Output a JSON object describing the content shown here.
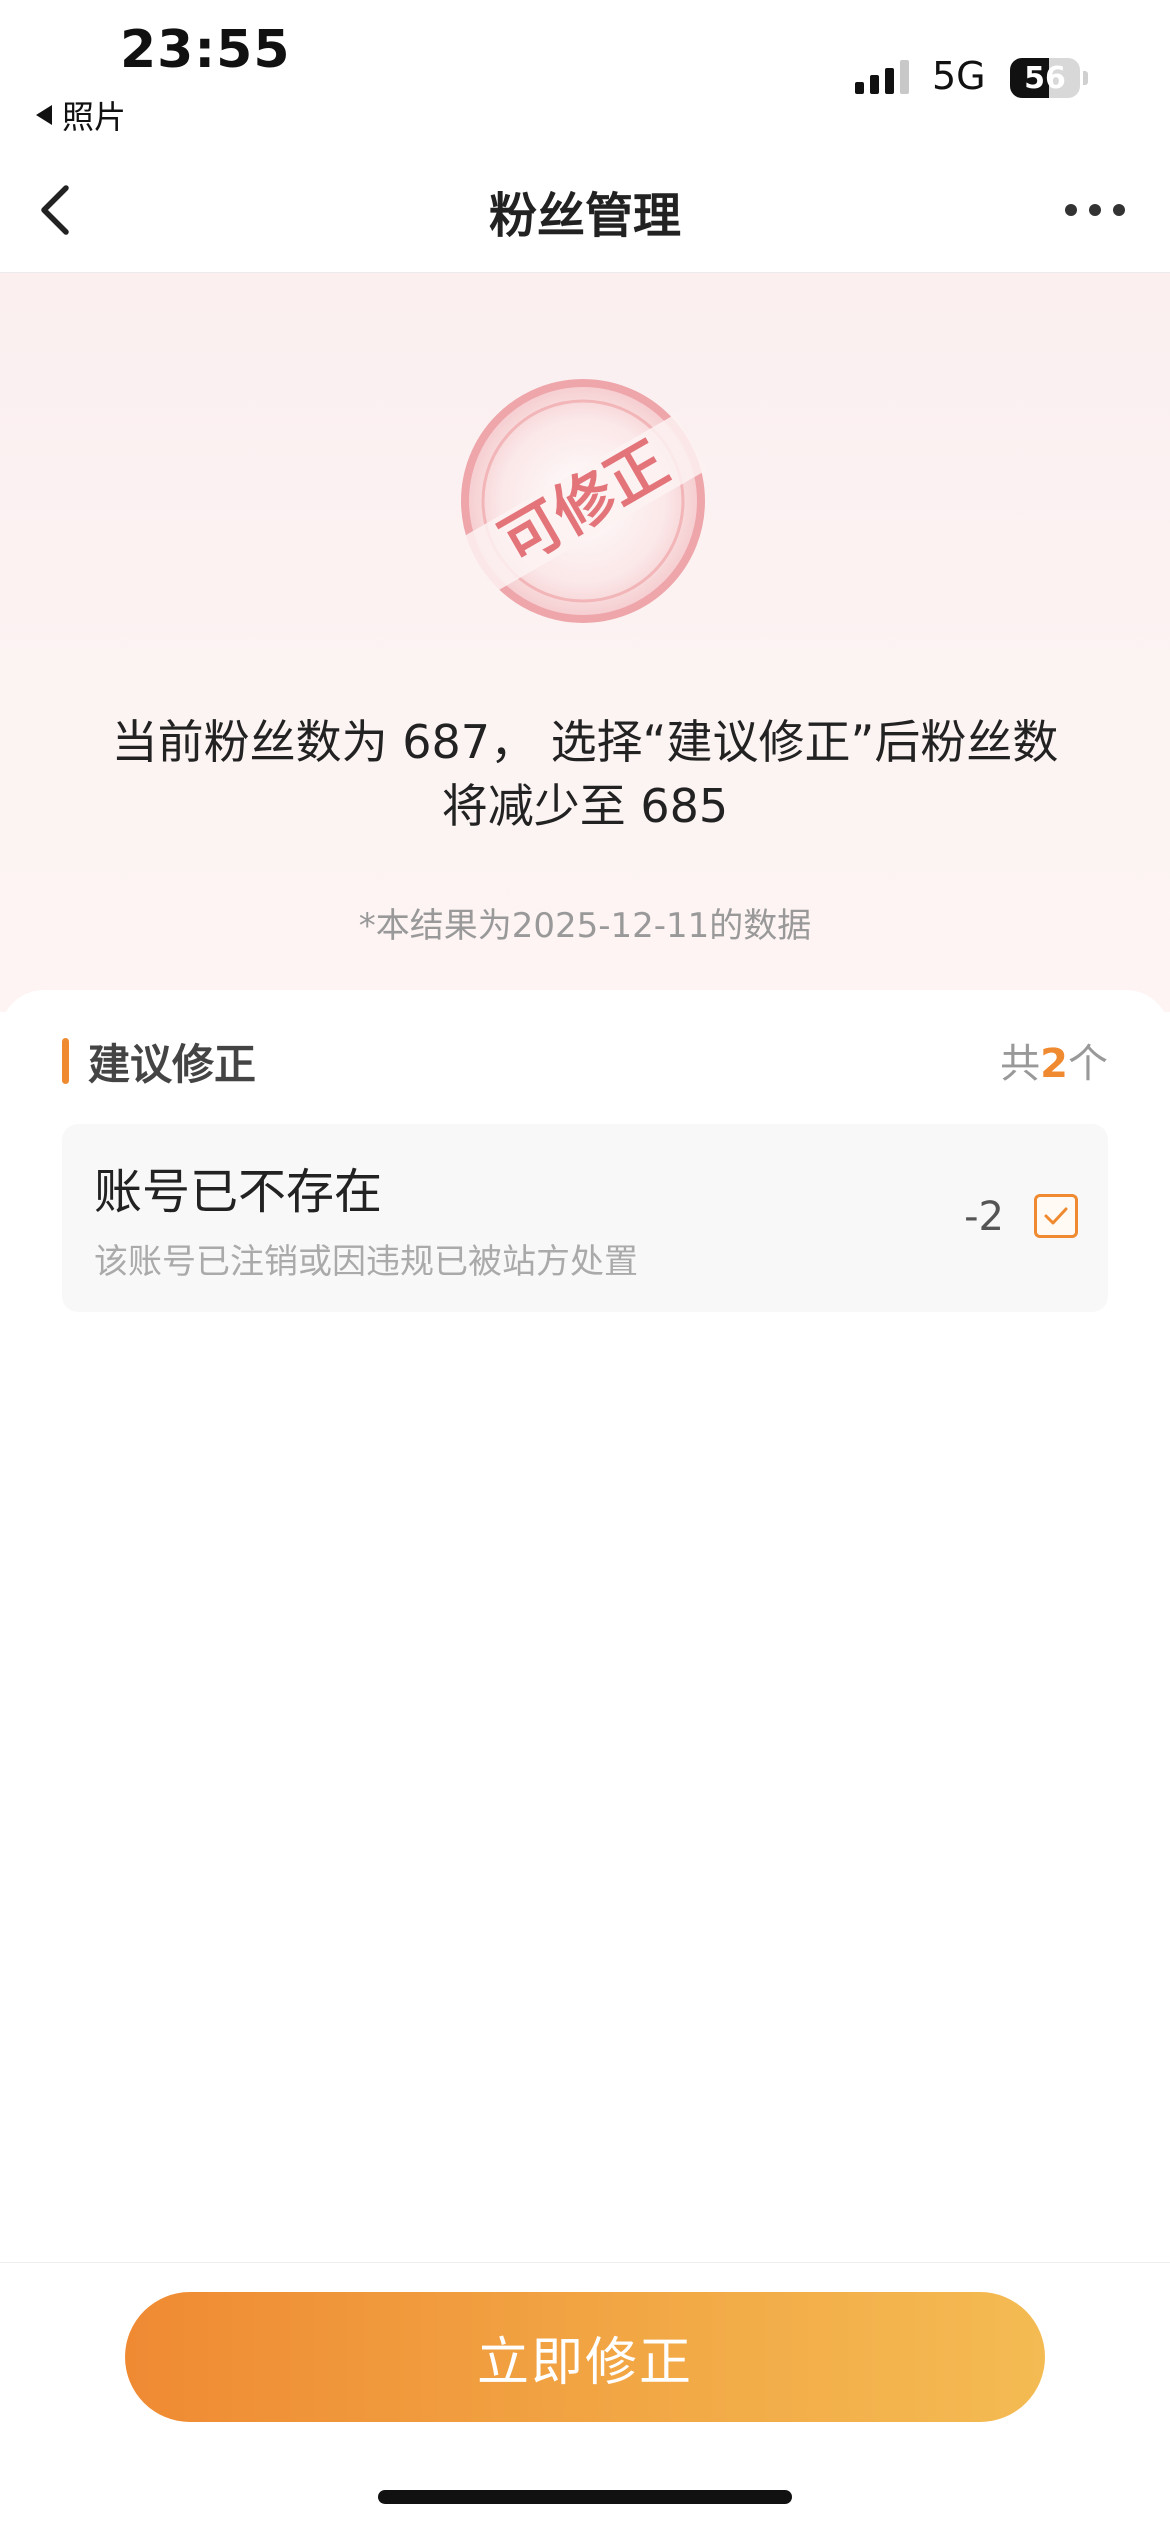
{
  "status_bar": {
    "time": "23:55",
    "back_app": "照片",
    "network": "5G",
    "battery": "56",
    "battery_level": 0.56
  },
  "nav": {
    "title": "粉丝管理"
  },
  "stamp": {
    "text": "可修正",
    "color": "#e2747a"
  },
  "summary": {
    "line1": "当前粉丝数为 687， 选择“建议修正”后粉丝数",
    "line2": "将减少至 685",
    "data_date": "*本结果为2025-12-11的数据"
  },
  "section": {
    "title": "建议修正",
    "count_prefix": "共",
    "count": "2",
    "count_suffix": "个",
    "accent": "#f08a30"
  },
  "items": [
    {
      "title": "账号已不存在",
      "desc": "该账号已注销或因违规已被站方处置",
      "delta": "-2",
      "checked": true
    }
  ],
  "footer": {
    "button_label": "立即修正"
  }
}
